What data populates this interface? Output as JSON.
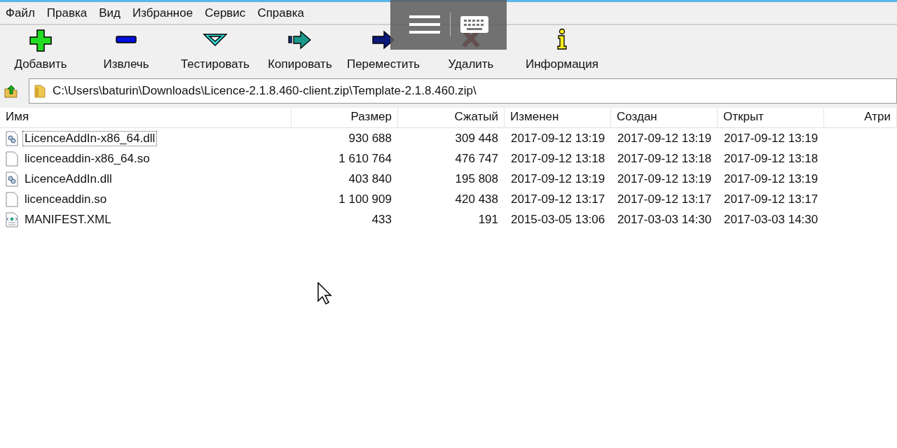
{
  "menu": [
    "Файл",
    "Правка",
    "Вид",
    "Избранное",
    "Сервис",
    "Справка"
  ],
  "toolbar": [
    {
      "kind": "add",
      "label": "Добавить"
    },
    {
      "kind": "extract",
      "label": "Извлечь"
    },
    {
      "kind": "test",
      "label": "Тестировать"
    },
    {
      "kind": "copy",
      "label": "Копировать"
    },
    {
      "kind": "move",
      "label": "Переместить"
    },
    {
      "kind": "delete",
      "label": "Удалить"
    },
    {
      "kind": "info",
      "label": "Информация"
    }
  ],
  "address": {
    "value": "C:\\Users\\baturin\\Downloads\\Licence-2.1.8.460-client.zip\\Template-2.1.8.460.zip\\"
  },
  "table": {
    "columns": [
      "Имя",
      "Размер",
      "Сжатый",
      "Изменен",
      "Создан",
      "Открыт",
      "Атри"
    ],
    "rows": [
      {
        "kind": "dll",
        "focused": true,
        "cells": [
          "LicenceAddIn-x86_64.dll",
          "930 688",
          "309 448",
          "2017-09-12 13:19",
          "2017-09-12 13:19",
          "2017-09-12 13:19"
        ]
      },
      {
        "kind": "file",
        "focused": false,
        "cells": [
          "licenceaddin-x86_64.so",
          "1 610 764",
          "476 747",
          "2017-09-12 13:18",
          "2017-09-12 13:18",
          "2017-09-12 13:18"
        ]
      },
      {
        "kind": "dll",
        "focused": false,
        "cells": [
          "LicenceAddIn.dll",
          "403 840",
          "195 808",
          "2017-09-12 13:19",
          "2017-09-12 13:19",
          "2017-09-12 13:19"
        ]
      },
      {
        "kind": "file",
        "focused": false,
        "cells": [
          "licenceaddin.so",
          "1 100 909",
          "420 438",
          "2017-09-12 13:17",
          "2017-09-12 13:17",
          "2017-09-12 13:17"
        ]
      },
      {
        "kind": "xml",
        "focused": false,
        "cells": [
          "MANIFEST.XML",
          "433",
          "191",
          "2015-03-05 13:06",
          "2017-03-03 14:30",
          "2017-03-03 14:30"
        ]
      }
    ]
  }
}
